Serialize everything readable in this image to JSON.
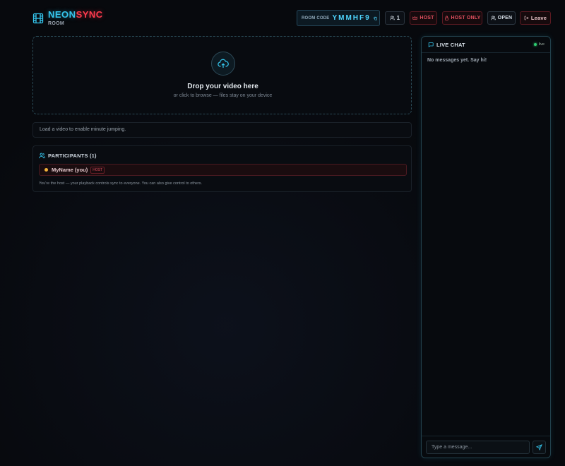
{
  "brand": {
    "name_part1": "NEON",
    "name_part2": "SYNC",
    "subtitle": "ROOM"
  },
  "header": {
    "room_code_label": "ROOM CODE",
    "room_code": "YMMHF9",
    "participant_count": "1",
    "host_label": "HOST",
    "host_only_label": "HOST ONLY",
    "open_label": "OPEN",
    "leave_label": "Leave"
  },
  "dropzone": {
    "title": "Drop your video here",
    "subtitle": "or click to browse — files stay on your device"
  },
  "jump_notice": "Load a video to enable minute jumping.",
  "participants": {
    "header": "PARTICIPANTS (1)",
    "items": [
      {
        "name": "MyName (you)",
        "badge": "HOST"
      }
    ],
    "note": "You're the host — your playback controls sync to everyone. You can also give control to others."
  },
  "chat": {
    "title": "LIVE CHAT",
    "status": "live",
    "empty_message": "No messages yet. Say hi!",
    "input_placeholder": "Type a message..."
  },
  "colors": {
    "accent_cyan": "#35c6ee",
    "accent_red": "#ff3b4e",
    "live_green": "#2ecc71",
    "host_dot": "#f2b23a"
  }
}
